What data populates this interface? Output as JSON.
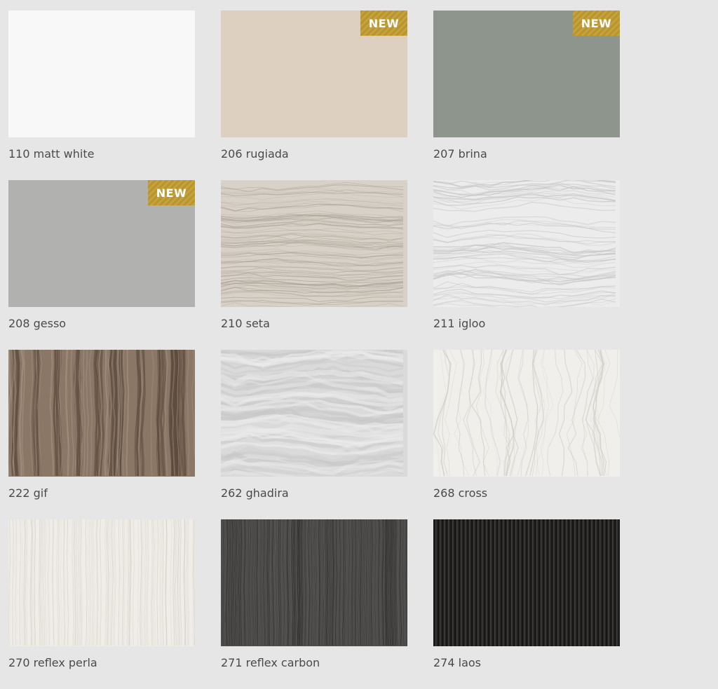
{
  "finishes": [
    {
      "label": "110 matt white",
      "color": "#f8f8f8",
      "texture": "plain",
      "badge": ""
    },
    {
      "label": "206 rugiada",
      "color": "#ded0c0",
      "texture": "plain",
      "badge": "NEW"
    },
    {
      "label": "207 brina",
      "color": "#8d958c",
      "texture": "plain",
      "badge": "NEW"
    },
    {
      "label": "208 gesso",
      "color": "#b1b1af",
      "texture": "plain",
      "badge": "NEW"
    },
    {
      "label": "210 seta",
      "color": "#d7d1c7",
      "texture": "wood-grain-light",
      "badge": ""
    },
    {
      "label": "211 igloo",
      "color": "#ececec",
      "texture": "wood-grain-white",
      "badge": ""
    },
    {
      "label": "222 gif",
      "color": "#8a7766",
      "texture": "wood-vertical",
      "badge": ""
    },
    {
      "label": "262 ghadira",
      "color": "#dadada",
      "texture": "concrete",
      "badge": ""
    },
    {
      "label": "268 cross",
      "color": "#f0efeb",
      "texture": "wood-cross",
      "badge": ""
    },
    {
      "label": "270 reflex perla",
      "color": "#efede7",
      "texture": "fine-vertical",
      "badge": ""
    },
    {
      "label": "271 reflex carbon",
      "color": "#4f4e4c",
      "texture": "fine-vertical-dark",
      "badge": ""
    },
    {
      "label": "274 laos",
      "color": "#2a2827",
      "texture": "ribbed-dark",
      "badge": ""
    }
  ]
}
